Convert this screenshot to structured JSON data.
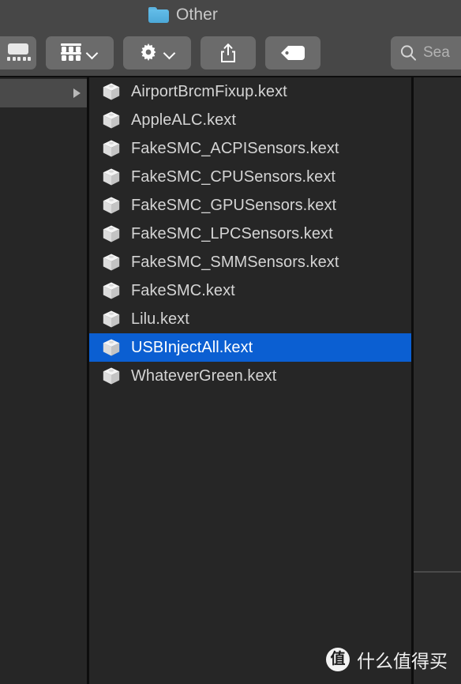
{
  "window": {
    "title": "Other",
    "folder_icon": "folder-icon"
  },
  "toolbar": {
    "buttons": [
      {
        "id": "coverflow-view",
        "icon": "coverflow-icon",
        "label": ""
      },
      {
        "id": "group-arrange",
        "icon": "grid-icon",
        "label": "",
        "has_chevron": true
      },
      {
        "id": "action-gear",
        "icon": "gear-icon",
        "label": "",
        "has_chevron": true
      },
      {
        "id": "share",
        "icon": "share-icon",
        "label": ""
      },
      {
        "id": "tags",
        "icon": "tag-icon",
        "label": ""
      }
    ],
    "search": {
      "icon": "search-icon",
      "placeholder": "Sea",
      "value": ""
    }
  },
  "columns": {
    "parent": {
      "row_disclosure_icon": "disclosure-triangle-icon"
    },
    "files": {
      "selected_index": 9,
      "selection_color": "#0b5fd2",
      "items": [
        {
          "name": "AirportBrcmFixup.kext",
          "icon": "kext-bundle-icon"
        },
        {
          "name": "AppleALC.kext",
          "icon": "kext-bundle-icon"
        },
        {
          "name": "FakeSMC_ACPISensors.kext",
          "icon": "kext-bundle-icon"
        },
        {
          "name": "FakeSMC_CPUSensors.kext",
          "icon": "kext-bundle-icon"
        },
        {
          "name": "FakeSMC_GPUSensors.kext",
          "icon": "kext-bundle-icon"
        },
        {
          "name": "FakeSMC_LPCSensors.kext",
          "icon": "kext-bundle-icon"
        },
        {
          "name": "FakeSMC_SMMSensors.kext",
          "icon": "kext-bundle-icon"
        },
        {
          "name": "FakeSMC.kext",
          "icon": "kext-bundle-icon"
        },
        {
          "name": "Lilu.kext",
          "icon": "kext-bundle-icon"
        },
        {
          "name": "USBInjectAll.kext",
          "icon": "kext-bundle-icon"
        },
        {
          "name": "WhateverGreen.kext",
          "icon": "kext-bundle-icon"
        }
      ]
    }
  },
  "watermark": {
    "badge": "值",
    "text": "什么值得买"
  },
  "colors": {
    "toolbar_bg": "#474747",
    "content_bg": "#262626",
    "button_bg": "#6b6b6b",
    "accent": "#0b5fd2",
    "text": "#d4d4d4",
    "folder_blue": "#5bb3e0"
  }
}
